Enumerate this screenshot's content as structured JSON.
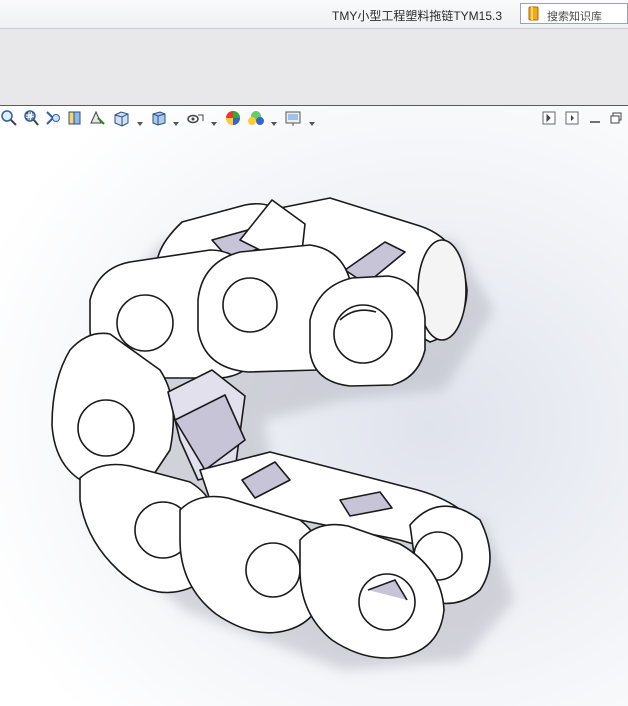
{
  "window": {
    "title": "TMY小型工程塑料拖链TYM15.3"
  },
  "search": {
    "placeholder": "搜索知识库",
    "icon": "knowledge-base-book-icon"
  },
  "heads_up_toolbar": {
    "items": [
      {
        "name": "zoom-to-fit-icon"
      },
      {
        "name": "zoom-to-area-icon"
      },
      {
        "name": "previous-view-icon"
      },
      {
        "name": "section-view-icon"
      },
      {
        "name": "dynamic-annotation-views-icon"
      },
      {
        "name": "view-orientation-icon",
        "dropdown": true
      },
      {
        "name": "display-style-icon",
        "dropdown": true
      },
      {
        "name": "hide-show-items-icon",
        "dropdown": true
      },
      {
        "name": "edit-appearance-icon"
      },
      {
        "name": "apply-scene-icon",
        "dropdown": true
      },
      {
        "name": "view-settings-icon",
        "dropdown": true
      }
    ],
    "window_controls": [
      {
        "name": "tile-horizontally-icon"
      },
      {
        "name": "tile-vertically-icon"
      },
      {
        "name": "minimize-icon"
      },
      {
        "name": "restore-icon"
      }
    ]
  },
  "model": {
    "description_icon": "cable-drag-chain-3d-model",
    "colors": {
      "link_face": "#ffffff",
      "link_edge": "#1a1a1a",
      "shadow": "#b8b8c2",
      "background_center": "#dfe3ec"
    }
  }
}
